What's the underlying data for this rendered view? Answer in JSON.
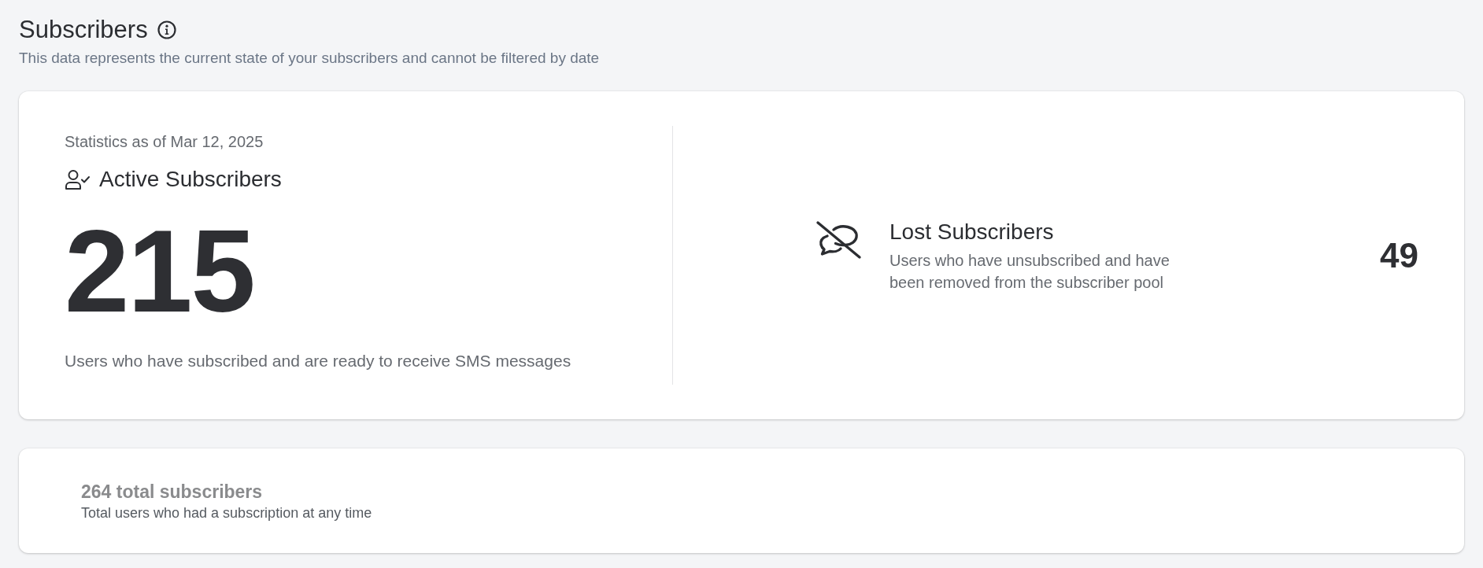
{
  "header": {
    "title": "Subscribers",
    "subtitle": "This data represents the current state of your subscribers and cannot be filtered by date"
  },
  "active": {
    "as_of": "Statistics as of Mar 12, 2025",
    "title": "Active Subscribers",
    "count": "215",
    "description": "Users who have subscribed and are ready to receive SMS messages"
  },
  "lost": {
    "title": "Lost Subscribers",
    "description": "Users who have unsubscribed and have been removed from the subscriber pool",
    "count": "49"
  },
  "total": {
    "title": "264 total subscribers",
    "description": "Total users who had a subscription at any time"
  }
}
